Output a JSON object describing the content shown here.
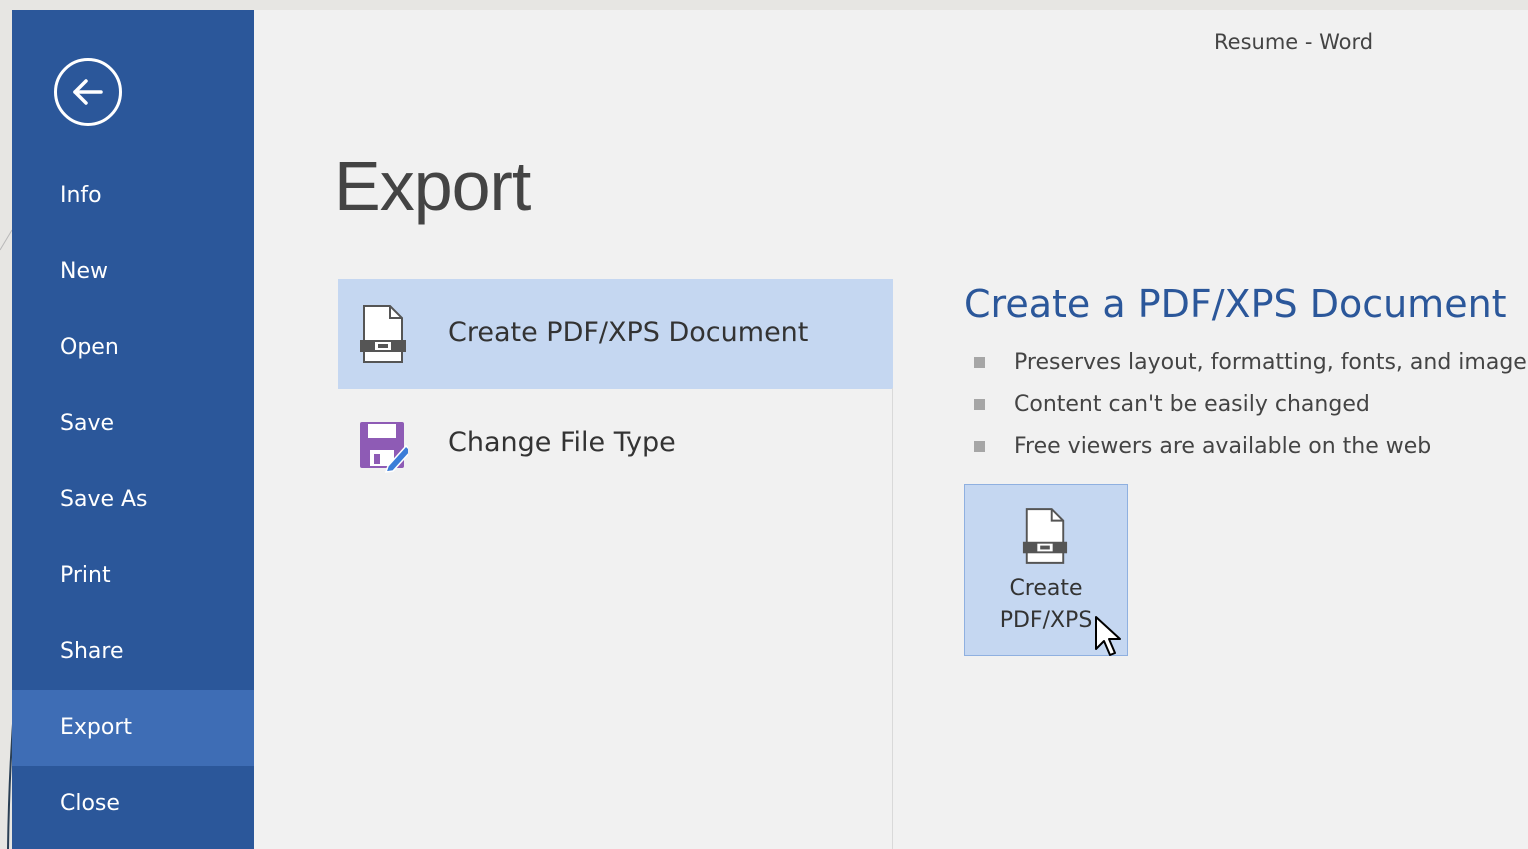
{
  "window": {
    "title": "Resume - Word"
  },
  "sidebar": {
    "back_icon": "back-arrow-icon",
    "items": [
      {
        "label": "Info",
        "active": false
      },
      {
        "label": "New",
        "active": false
      },
      {
        "label": "Open",
        "active": false
      },
      {
        "label": "Save",
        "active": false
      },
      {
        "label": "Save As",
        "active": false
      },
      {
        "label": "Print",
        "active": false
      },
      {
        "label": "Share",
        "active": false
      },
      {
        "label": "Export",
        "active": true
      },
      {
        "label": "Close",
        "active": false
      }
    ]
  },
  "main": {
    "title": "Export",
    "options": [
      {
        "label": "Create PDF/XPS Document",
        "icon": "pdf-document-icon",
        "selected": true
      },
      {
        "label": "Change File Type",
        "icon": "save-as-edit-icon",
        "selected": false
      }
    ]
  },
  "detail": {
    "title": "Create a PDF/XPS Document",
    "bullets": [
      "Preserves layout, formatting, fonts, and images",
      "Content can't be easily changed",
      "Free viewers are available on the web"
    ],
    "button": {
      "line1": "Create",
      "line2": "PDF/XPS",
      "icon": "pdf-document-icon"
    }
  },
  "colors": {
    "sidebar": "#2b579a",
    "sidebar_active": "#3e6db5",
    "selected": "#c5d7f1",
    "accent_text": "#2b579a",
    "change_file_icon": "#8e5bb5"
  }
}
